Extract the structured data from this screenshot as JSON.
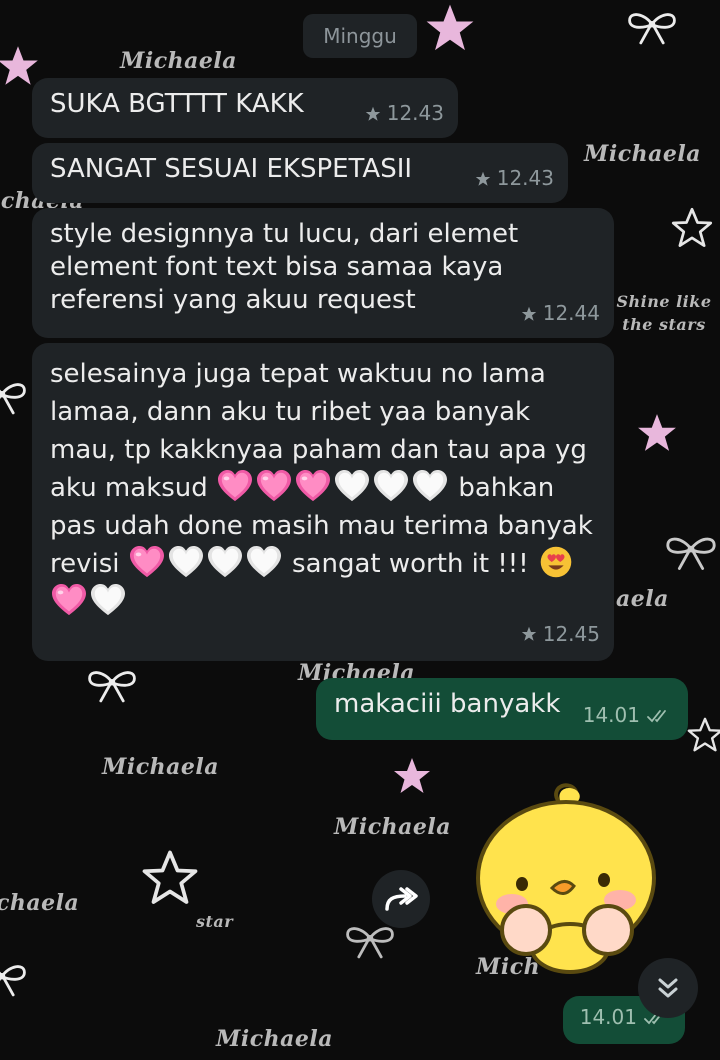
{
  "date_chip": "Minggu",
  "wallpaper": {
    "watermark": "Michaela",
    "watermark_cut1": "aela",
    "watermark_cut2": "ichaela",
    "watermark_cut3": "chaela",
    "watermark_cut4": "Mich",
    "tagline": "Shine like the stars",
    "star_word": "star"
  },
  "messages": [
    {
      "text": "SUKA BGTTTT KAKK",
      "time": "12.43"
    },
    {
      "text": "SANGAT SESUAI EKSPETASII",
      "time": "12.43"
    },
    {
      "text": "style designnya tu lucu, dari elemet element font text bisa samaa kaya referensi yang akuu request",
      "time": "12.44"
    },
    {
      "part1": "selesainya juga tepat waktuu no lama lamaa, dann aku tu ribet yaa banyak mau, tp kakknyaa paham dan tau apa yg aku maksud",
      "part2": "bahkan pas udah done masih mau terima banyak revisi",
      "part3": "sangat worth it !!!",
      "time": "12.45"
    }
  ],
  "outgoing": [
    {
      "text": "makaciii banyakk",
      "time": "14.01",
      "status_icon": "double-check-icon"
    },
    {
      "type": "sticker",
      "description_icon": "yellow-chick-sticker",
      "time": "14.01"
    }
  ],
  "icons": {
    "star": "star-icon",
    "pink_heart": "pink-heart-icon",
    "white_heart": "white-heart-icon",
    "heart_eyes": "heart-eyes-emoji-icon",
    "forward": "forward-icon",
    "scroll_down": "double-chevron-down-icon"
  },
  "colors": {
    "incoming_bubble": "#1f2326",
    "outgoing_bubble": "#134d37",
    "background": "#0c0c0c",
    "accent_pink": "#e8b7dc"
  }
}
